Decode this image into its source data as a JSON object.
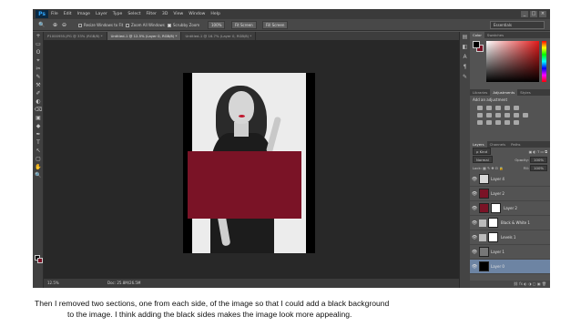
{
  "app": {
    "logo": "Ps",
    "menus": [
      "File",
      "Edit",
      "Image",
      "Layer",
      "Type",
      "Select",
      "Filter",
      "3D",
      "View",
      "Window",
      "Help"
    ],
    "window_controls": [
      "_",
      "□",
      "×"
    ]
  },
  "options_bar": {
    "zoom_in_icon": "zoom-in-icon",
    "zoom_out_icon": "zoom-out-icon",
    "checkboxes": [
      "Resize Windows to Fit",
      "Zoom All Windows",
      "Scrubby Zoom"
    ],
    "buttons": [
      "100%",
      "Fit Screen",
      "Fill Screen"
    ],
    "workspace": "Essentials"
  },
  "doc_tabs": [
    {
      "label": "P1000955.JPG @ 33% (RGB/8) *",
      "active": false
    },
    {
      "label": "Untitled-1 @ 12.5% (Layer 0, RGB/8) *",
      "active": true
    },
    {
      "label": "Untitled-1 @ 16.7% (Layer 0, RGB/8) *",
      "active": false
    }
  ],
  "tools": [
    "+",
    "▭",
    "ʘ",
    "⌖",
    "✂",
    "✎",
    "⚒",
    "✐",
    "◐",
    "⌫",
    "▣",
    "◆",
    "✒",
    "T",
    "↖",
    "▢",
    "✋",
    "🔍"
  ],
  "canvas": {
    "foreground_color": "#000000",
    "background_color": "#7a1326",
    "red_rect_color": "#7a1326"
  },
  "status_bar": {
    "zoom": "12.5%",
    "doc": "Doc: 25.8M/26.5M"
  },
  "panels": {
    "color_tabs": [
      "Color",
      "Swatches"
    ],
    "adjust_tabs": [
      "Libraries",
      "Adjustments",
      "Styles"
    ],
    "adjust_title": "Add an adjustment",
    "layers_tabs": [
      "Layers",
      "Channels",
      "Paths"
    ],
    "kind": "ρ Kind",
    "blend_mode": "Normal",
    "opacity_label": "Opacity:",
    "opacity_value": "100%",
    "lock_label": "Lock:",
    "fill_label": "Fill:",
    "fill_value": "100%",
    "layers": [
      {
        "name": "Layer 4",
        "thumb": "#d8d8d8",
        "mask": false,
        "adjustment": false,
        "selected": false
      },
      {
        "name": "Layer 2",
        "thumb": "#7a1326",
        "mask": false,
        "adjustment": false,
        "selected": false
      },
      {
        "name": "Layer 2",
        "thumb": "#7a1326",
        "mask": true,
        "adjustment": false,
        "selected": false
      },
      {
        "name": "Black & White 1",
        "thumb": "",
        "mask": true,
        "adjustment": true,
        "selected": false
      },
      {
        "name": "Levels 1",
        "thumb": "",
        "mask": true,
        "adjustment": true,
        "selected": false
      },
      {
        "name": "Layer 1",
        "thumb": "#777777",
        "mask": false,
        "adjustment": false,
        "selected": false
      },
      {
        "name": "Layer 0",
        "thumb": "#000000",
        "mask": false,
        "adjustment": false,
        "selected": true
      }
    ]
  },
  "caption": {
    "line1": "Then I removed two sections, one from each side, of the image so that I could add a black background",
    "line2": "to the image. I think adding the black sides makes the image look more appealing."
  }
}
